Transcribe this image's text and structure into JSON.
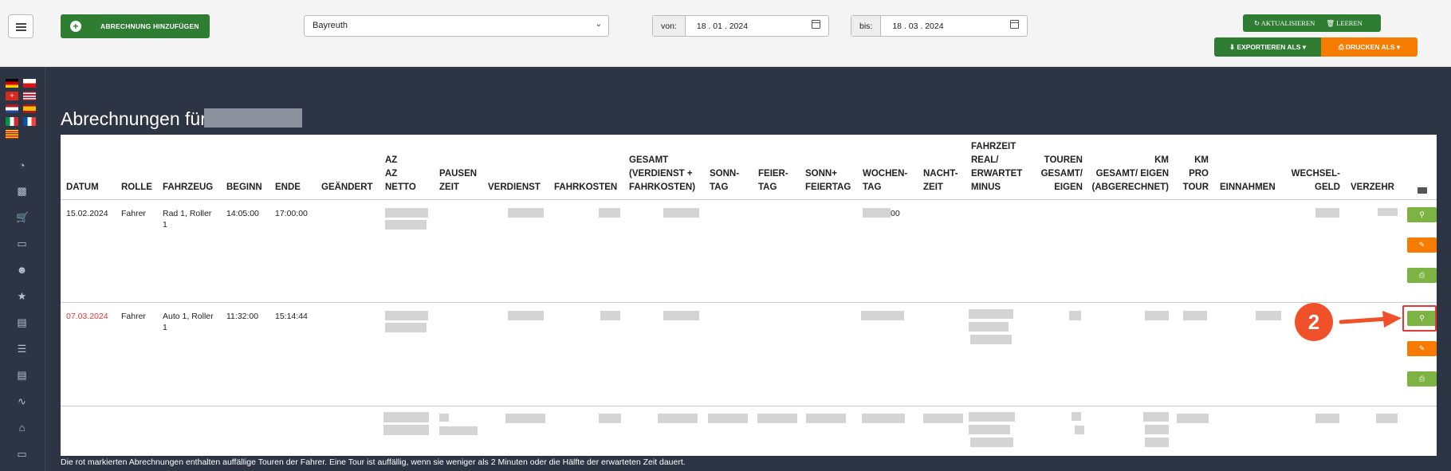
{
  "toolbar": {
    "add_label": "ABRECHNUNG HINZUFÜGEN",
    "location": "Bayreuth",
    "from_label": "von:",
    "from_value": "18 . 01 . 2024",
    "to_label": "bis:",
    "to_value": "18 . 03 . 2024",
    "refresh_label": "AKTUALISIEREN",
    "clear_label": "LEEREN",
    "export_label": "EXPORTIEREN ALS",
    "print_label": "DRUCKEN ALS"
  },
  "page": {
    "title": "Abrechnungen für"
  },
  "table": {
    "headers": {
      "datum": "DATUM",
      "rolle": "ROLLE",
      "fahrzeug": "FAHRZEUG",
      "beginn": "BEGINN",
      "ende": "ENDE",
      "geaendert": "GEÄNDERT",
      "az1": "AZ",
      "az2": "AZ",
      "az3": "NETTO",
      "pausen1": "PAUSEN",
      "pausen2": "ZEIT",
      "verdienst": "VERDIENST",
      "fahrkosten": "FAHRKOSTEN",
      "gesamt1": "GESAMT",
      "gesamt2": "(VERDIENST +",
      "gesamt3": "FAHRKOSTEN)",
      "sonn1": "SONN-",
      "sonn2": "TAG",
      "feier1": "FEIER-",
      "feier2": "TAG",
      "sf1": "SONN+",
      "sf2": "FEIERTAG",
      "wochen1": "WOCHEN-",
      "wochen2": "TAG",
      "nacht1": "NACHT-",
      "nacht2": "ZEIT",
      "fz1": "FAHRZEIT",
      "fz2": "REAL/",
      "fz3": "ERWARTET",
      "fz4": "MINUS",
      "touren1": "TOUREN",
      "touren2": "GESAMT/",
      "touren3": "EIGEN",
      "km1": "KM",
      "km2": "GESAMT/ EIGEN",
      "km3": "(ABGERECHNET)",
      "kmt1": "KM",
      "kmt2": "PRO",
      "kmt3": "TOUR",
      "einnahmen": "EINNAHMEN",
      "wechsel1": "WECHSEL-",
      "wechsel2": "GELD",
      "verzehr": "VERZEHR"
    },
    "rows": [
      {
        "date": "15.02.2024",
        "role": "Fahrer",
        "vehicle": "Rad 1, Roller 1",
        "start": "14:05:00",
        "end": "17:00:00",
        "wochentag_suffix": "00"
      },
      {
        "date": "07.03.2024",
        "role": "Fahrer",
        "vehicle": "Auto 1, Roller 1",
        "start": "11:32:00",
        "end": "15:14:44"
      }
    ]
  },
  "footer_note": "Die rot markierten Abrechnungen enthalten auffällige Touren der Fahrer. Eine Tour ist auffällig, wenn sie weniger als 2 Minuten oder die Hälfte der erwarteten Zeit dauert.",
  "annotation": {
    "step": "2"
  },
  "colors": {
    "alert_red": "#e53935",
    "primary_green": "#2e7d32",
    "accent_orange": "#f57c00",
    "action_green": "#7cb342"
  }
}
